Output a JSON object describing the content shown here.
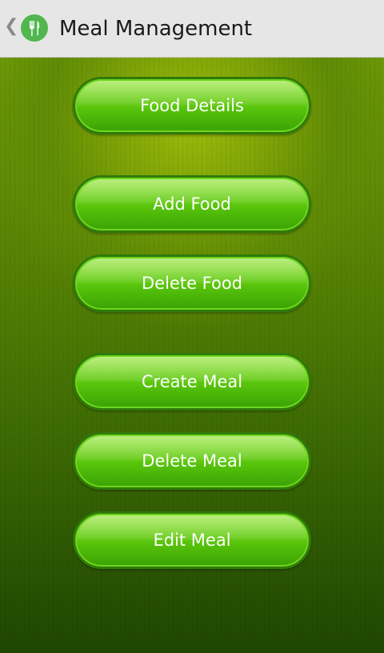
{
  "header": {
    "title": "Meal Management",
    "back_icon": "chevron-left-icon",
    "app_icon": "cutlery-icon",
    "app_icon_color": "#52b64f"
  },
  "buttons": {
    "food_details": "Food Details",
    "add_food": "Add Food",
    "delete_food": "Delete Food",
    "create_meal": "Create Meal",
    "delete_meal": "Delete Meal",
    "edit_meal": "Edit Meal"
  },
  "colors": {
    "button_green": "#58c40b",
    "background_green": "#5f8b06",
    "action_bar": "#e6e6e6"
  }
}
